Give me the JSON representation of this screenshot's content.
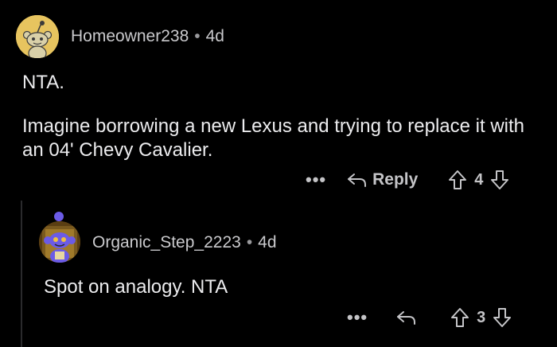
{
  "comments": [
    {
      "author": "Homeowner238",
      "separator": "•",
      "age": "4d",
      "paragraphs": [
        "NTA.",
        "Imagine borrowing a new Lexus and trying to replace it with an 04' Chevy Cavalier."
      ],
      "more_label": "•••",
      "reply_label": "Reply",
      "score": "4",
      "avatar": "snoo-avatar-yellow"
    },
    {
      "author": "Organic_Step_2223",
      "separator": "•",
      "age": "4d",
      "paragraphs": [
        "Spot on analogy. NTA"
      ],
      "more_label": "•••",
      "score": "3",
      "avatar": "snoo-avatar-purple"
    }
  ],
  "colors": {
    "background": "#000000",
    "text": "#ececee",
    "muted": "#c4c4c7",
    "avatar_yellow": "#e7c45f",
    "avatar_purple": "#6b5be6"
  }
}
